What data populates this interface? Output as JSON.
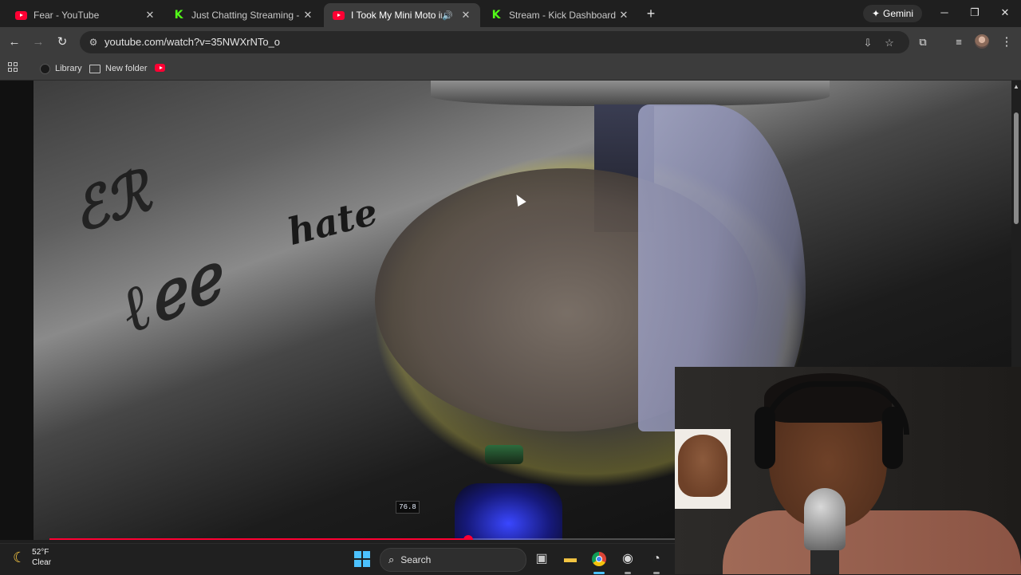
{
  "tabs": [
    {
      "title": "Fear - YouTube",
      "favicon": "youtube-icon",
      "active": false
    },
    {
      "title": "Just Chatting Streaming - Live S",
      "favicon": "kick-icon",
      "active": false
    },
    {
      "title": "I Took My Mini Moto into T",
      "favicon": "youtube-icon",
      "active": true,
      "audio": true
    },
    {
      "title": "Stream - Kick Dashboard",
      "favicon": "kick-icon",
      "active": false
    }
  ],
  "gemini_label": "Gemini",
  "address": {
    "url": "youtube.com/watch?v=35NWXrNTo_o"
  },
  "bookmarks": [
    {
      "label": "Library",
      "icon": "library-icon"
    },
    {
      "label": "New folder",
      "icon": "folder-icon"
    }
  ],
  "video": {
    "progress_fraction": 0.43,
    "graffiti_text": "hate",
    "speedometer": "76.8"
  },
  "taskbar": {
    "temperature": "52°F",
    "condition": "Clear",
    "search_label": "Search"
  },
  "colors": {
    "youtube_red": "#ff0033",
    "kick_green": "#53fc18",
    "windows_blue": "#4cc2ff"
  }
}
